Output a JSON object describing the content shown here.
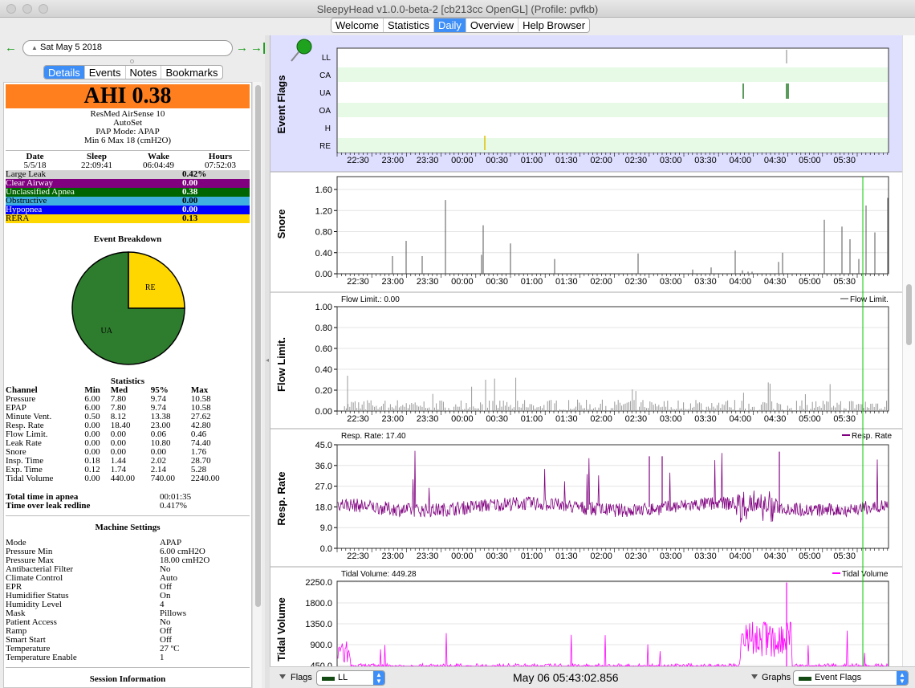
{
  "window": {
    "title": "SleepyHead v1.0.0-beta-2 [cb213cc OpenGL] (Profile: pvfkb)"
  },
  "main_tabs": [
    {
      "label": "Welcome",
      "active": false
    },
    {
      "label": "Statistics",
      "active": false
    },
    {
      "label": "Daily",
      "active": true
    },
    {
      "label": "Overview",
      "active": false
    },
    {
      "label": "Help Browser",
      "active": false
    }
  ],
  "nav": {
    "date": "Sat May 5 2018",
    "date_icon": "triangle-up-icon"
  },
  "detail_tabs": [
    {
      "label": "Details",
      "active": true
    },
    {
      "label": "Events",
      "active": false
    },
    {
      "label": "Notes",
      "active": false
    },
    {
      "label": "Bookmarks",
      "active": false
    }
  ],
  "summary": {
    "ahi": "AHI 0.38",
    "machine": [
      "ResMed AirSense 10",
      "AutoSet",
      "PAP Mode: APAP",
      "Min 6 Max 18 (cmH2O)"
    ],
    "date_h": "Date",
    "sleep_h": "Sleep",
    "wake_h": "Wake",
    "hours_h": "Hours",
    "date": "5/5/18",
    "sleep": "22:09:41",
    "wake": "06:04:49",
    "hours": "07:52:03"
  },
  "events": [
    {
      "label": "Large Leak",
      "value": "0.42%",
      "bg": "#d3d3d3",
      "fg": "#000000"
    },
    {
      "label": "Clear Airway",
      "value": "0.00",
      "bg": "#800080",
      "fg": "#ffffff"
    },
    {
      "label": "Unclassified Apnea",
      "value": "0.38",
      "bg": "#006400",
      "fg": "#ffffff"
    },
    {
      "label": "Obstructive",
      "value": "0.00",
      "bg": "#40b0e0",
      "fg": "#000000"
    },
    {
      "label": "Hypopnea",
      "value": "0.00",
      "bg": "#0000ff",
      "fg": "#ffffff"
    },
    {
      "label": "RERA",
      "value": "0.13",
      "bg": "#ffd700",
      "fg": "#000000"
    }
  ],
  "breakdown": {
    "title": "Event Breakdown",
    "slices": [
      {
        "label": "RE",
        "value": 0.25,
        "color": "#ffd700"
      },
      {
        "label": "UA",
        "value": 0.75,
        "color": "#2e7d2e"
      }
    ]
  },
  "stats": {
    "title": "Statistics",
    "headers": [
      "Channel",
      "Min",
      "Med",
      "95%",
      "Max"
    ],
    "rows": [
      [
        "Pressure",
        "6.00",
        "7.80",
        "9.74",
        "10.58"
      ],
      [
        "EPAP",
        "6.00",
        "7.80",
        "9.74",
        "10.58"
      ],
      [
        "Minute Vent.",
        "0.50",
        "8.12",
        "13.38",
        "27.62"
      ],
      [
        "Resp. Rate",
        "0.00",
        "18.40",
        "23.00",
        "42.80"
      ],
      [
        "Flow Limit.",
        "0.00",
        "0.00",
        "0.06",
        "0.46"
      ],
      [
        "Leak Rate",
        "0.00",
        "0.00",
        "10.80",
        "74.40"
      ],
      [
        "Snore",
        "0.00",
        "0.00",
        "0.00",
        "1.76"
      ],
      [
        "Insp. Time",
        "0.18",
        "1.44",
        "2.02",
        "28.70"
      ],
      [
        "Exp. Time",
        "0.12",
        "1.74",
        "2.14",
        "5.28"
      ],
      [
        "Tidal Volume",
        "0.00",
        "440.00",
        "740.00",
        "2240.00"
      ]
    ],
    "apnea_label": "Total time in apnea",
    "apnea_value": "00:01:35",
    "leak_label": "Time over leak redline",
    "leak_value": "0.417%"
  },
  "settings": {
    "title": "Machine Settings",
    "rows": [
      [
        "Mode",
        "APAP"
      ],
      [
        "Pressure Min",
        "6.00 cmH2O"
      ],
      [
        "Pressure Max",
        "18.00 cmH2O"
      ],
      [
        "Antibacterial Filter",
        "No"
      ],
      [
        "Climate Control",
        "Auto"
      ],
      [
        "EPR",
        "Off"
      ],
      [
        "Humidifier Status",
        "On"
      ],
      [
        "Humidity Level",
        "4"
      ],
      [
        "Mask",
        "Pillows"
      ],
      [
        "Patient Access",
        "No"
      ],
      [
        "Ramp",
        "Off"
      ],
      [
        "Smart Start",
        "Off"
      ],
      [
        "Temperature",
        "27 ºC"
      ],
      [
        "Temperature Enable",
        "1"
      ]
    ],
    "session_title": "Session Information"
  },
  "time_ticks": [
    "22:30",
    "23:00",
    "23:30",
    "00:00",
    "00:30",
    "01:00",
    "01:30",
    "02:00",
    "02:30",
    "03:00",
    "03:30",
    "04:00",
    "04:30",
    "05:00",
    "05:30"
  ],
  "graphs": {
    "event_flags": {
      "ylabel": "Event Flags",
      "rows": [
        "LL",
        "CA",
        "UA",
        "OA",
        "H",
        "RE"
      ],
      "pin_icon": "pushpin-icon"
    },
    "snore": {
      "ylabel": "Snore",
      "ticks": [
        "1.60",
        "1.20",
        "0.80",
        "0.40",
        "0.00"
      ],
      "color": "#555555"
    },
    "flow": {
      "ylabel": "Flow Limit.",
      "readout": "Flow Limit.: 0.00",
      "legend": "Flow Limit.",
      "ticks": [
        "1.00",
        "0.80",
        "0.60",
        "0.40",
        "0.20",
        "0.00"
      ],
      "color": "#999999"
    },
    "resp": {
      "ylabel": "Resp. Rate",
      "readout": "Resp. Rate: 17.40",
      "legend": "Resp. Rate",
      "ticks": [
        "45.0",
        "36.0",
        "27.0",
        "18.0",
        "9.0",
        "0.0"
      ],
      "color": "#800080"
    },
    "tidal": {
      "ylabel": "Tidal Volume",
      "readout": "Tidal Volume: 449.28",
      "legend": "Tidal Volume",
      "ticks": [
        "2250.0",
        "1800.0",
        "1350.0",
        "900.0",
        "450.0"
      ],
      "color": "#ff00ff"
    }
  },
  "bottom": {
    "flags_label": "Flags",
    "flags_value": "LL",
    "time": "May 06 05:43:02.856",
    "graphs_label": "Graphs",
    "graphs_value": "Event Flags"
  }
}
